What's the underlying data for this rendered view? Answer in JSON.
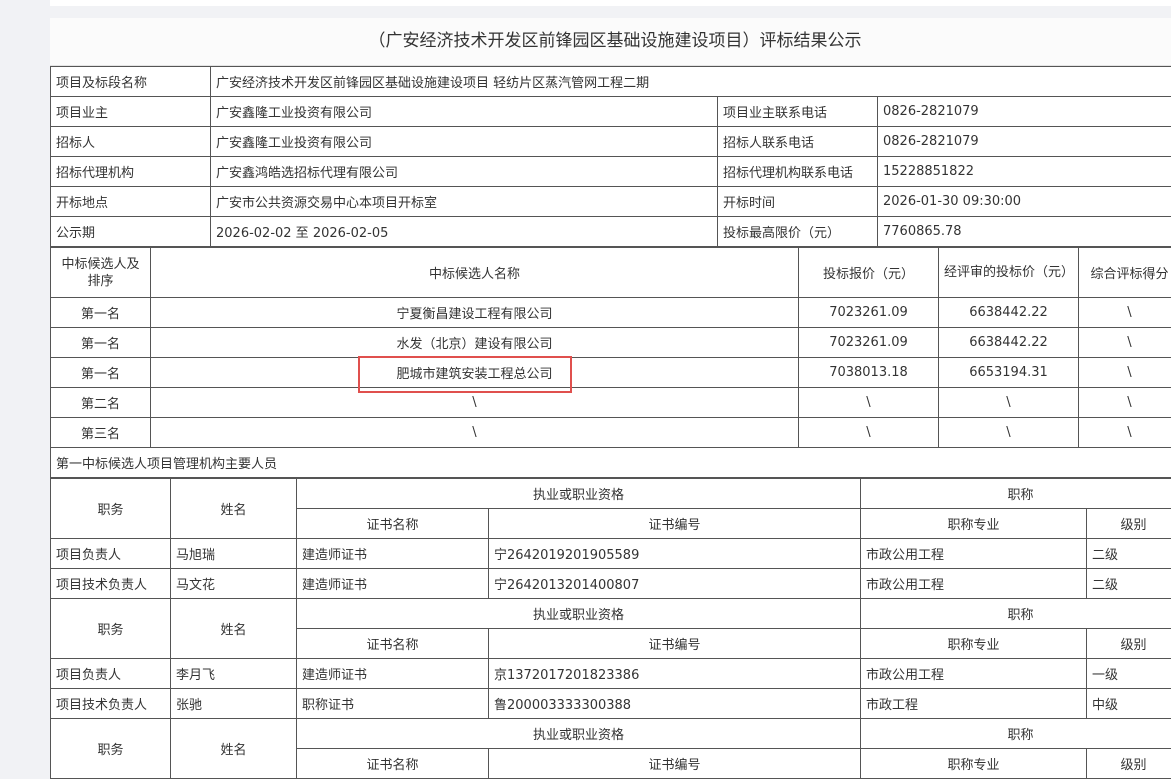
{
  "title": "（广安经济技术开发区前锋园区基础设施建设项目）评标结果公示",
  "info": [
    {
      "label": "项目及标段名称",
      "value": "广安经济技术开发区前锋园区基础设施建设项目 轻纺片区蒸汽管网工程二期"
    },
    {
      "label": "项目业主",
      "value": "广安鑫隆工业投资有限公司",
      "label2": "项目业主联系电话",
      "value2": "0826-2821079"
    },
    {
      "label": "招标人",
      "value": "广安鑫隆工业投资有限公司",
      "label2": "招标人联系电话",
      "value2": "0826-2821079"
    },
    {
      "label": "招标代理机构",
      "value": "广安鑫鸿皓选招标代理有限公司",
      "label2": "招标代理机构联系电话",
      "value2": "15228851822"
    },
    {
      "label": "开标地点",
      "value": "广安市公共资源交易中心本项目开标室",
      "label2": "开标时间",
      "value2": "2026-01-30 09:30:00"
    },
    {
      "label": "公示期",
      "value": "2026-02-02 至 2026-02-05",
      "label2": "投标最高限价（元）",
      "value2": "7760865.78"
    }
  ],
  "candidates": {
    "headers": [
      "中标候选人及排序",
      "中标候选人名称",
      "投标报价（元）",
      "经评审的投标价（元）",
      "综合评标得分"
    ],
    "rows": [
      {
        "rank": "第一名",
        "name": "宁夏衡昌建设工程有限公司",
        "bid": "7023261.09",
        "eval": "6638442.22",
        "score": "\\"
      },
      {
        "rank": "第一名",
        "name": "水发（北京）建设有限公司",
        "bid": "7023261.09",
        "eval": "6638442.22",
        "score": "\\"
      },
      {
        "rank": "第一名",
        "name": "肥城市建筑安装工程总公司",
        "bid": "7038013.18",
        "eval": "6653194.31",
        "score": "\\"
      },
      {
        "rank": "第二名",
        "name": "\\",
        "bid": "\\",
        "eval": "\\",
        "score": "\\"
      },
      {
        "rank": "第三名",
        "name": "\\",
        "bid": "\\",
        "eval": "\\",
        "score": "\\"
      }
    ]
  },
  "personnel_section_title": "第一中标候选人项目管理机构主要人员",
  "personnel_headers": {
    "role": "职务",
    "name": "姓名",
    "qualification": "执业或职业资格",
    "title": "职称",
    "cert_name": "证书名称",
    "cert_no": "证书编号",
    "title_major": "职称专业",
    "level": "级别"
  },
  "personnel_groups": [
    {
      "rows": [
        {
          "role": "项目负责人",
          "name": "马旭瑞",
          "cert_name": "建造师证书",
          "cert_no": "宁2642019201905589",
          "major": "市政公用工程",
          "level": "二级"
        },
        {
          "role": "项目技术负责人",
          "name": "马文花",
          "cert_name": "建造师证书",
          "cert_no": "宁2642013201400807",
          "major": "市政公用工程",
          "level": "二级"
        }
      ]
    },
    {
      "rows": [
        {
          "role": "项目负责人",
          "name": "李月飞",
          "cert_name": "建造师证书",
          "cert_no": "京1372017201823386",
          "major": "市政公用工程",
          "level": "一级"
        },
        {
          "role": "项目技术负责人",
          "name": "张驰",
          "cert_name": "职称证书",
          "cert_no": "鲁200003333300388",
          "major": "市政工程",
          "level": "中级"
        }
      ]
    }
  ]
}
